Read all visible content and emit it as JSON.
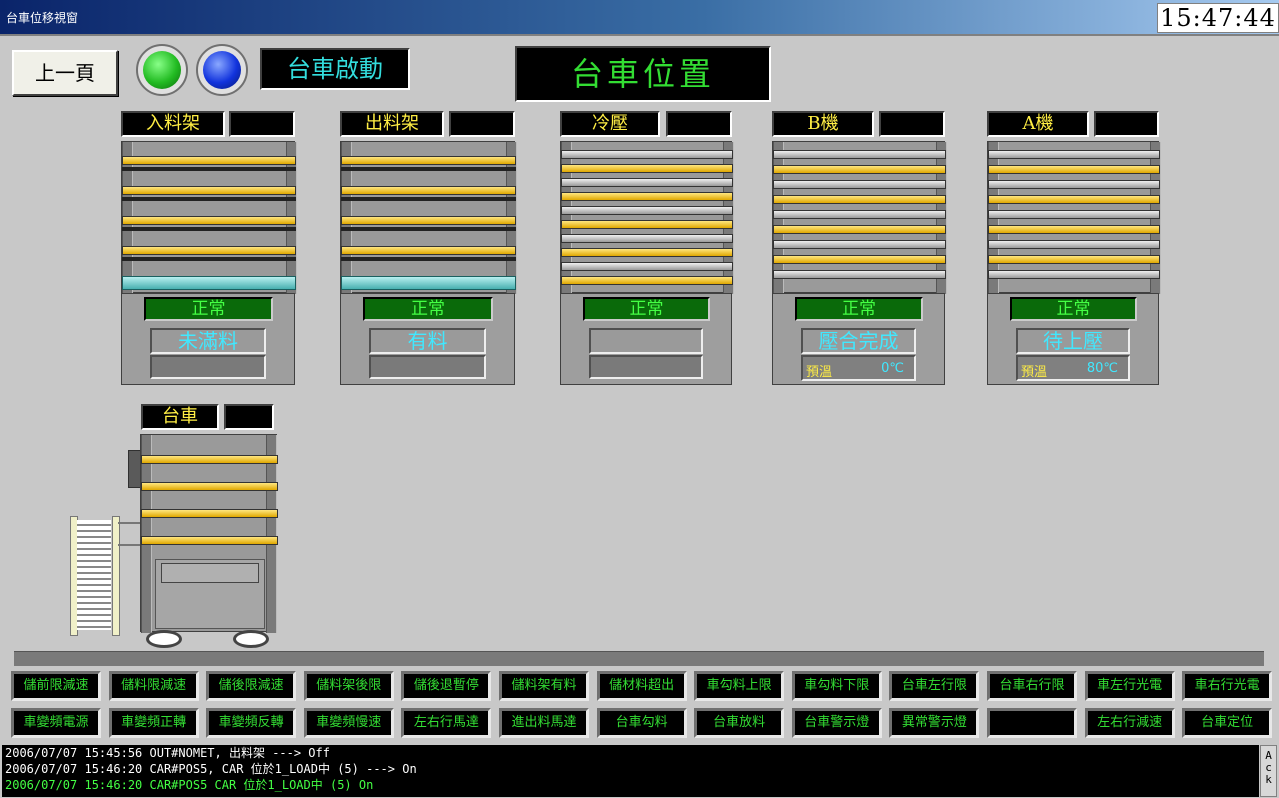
{
  "window": {
    "title": "台車位移視窗",
    "clock": "15:47:44"
  },
  "top": {
    "back_label": "上一頁",
    "start_label": "台車啟動",
    "position_title": "台車位置"
  },
  "colors": {
    "lamp_green": "#22bb22",
    "lamp_blue": "#1133dd",
    "accent_green": "#33dd33",
    "shelf_yellow": "#f2c200"
  },
  "stations": [
    {
      "label": "入料架",
      "value": "",
      "status": "正常",
      "message": "未滿料",
      "detail": ""
    },
    {
      "label": "出料架",
      "value": "",
      "status": "正常",
      "message": "有料",
      "detail": ""
    },
    {
      "label": "冷壓",
      "value": "",
      "status": "正常",
      "message": "",
      "detail": ""
    },
    {
      "label": "B機",
      "value": "",
      "status": "正常",
      "message": "壓合完成",
      "temp_label": "預溫",
      "temp_value": "0℃"
    },
    {
      "label": "A機",
      "value": "",
      "status": "正常",
      "message": "待上壓",
      "temp_label": "預溫",
      "temp_value": "80℃"
    }
  ],
  "cart": {
    "label": "台車",
    "value": ""
  },
  "indicators_row1": [
    "儲前限減速",
    "儲料限減速",
    "儲後限減速",
    "儲料架後限",
    "儲後退暫停",
    "儲料架有料",
    "儲材料超出",
    "車勾料上限",
    "車勾料下限",
    "台車左行限",
    "台車右行限",
    "車左行光電",
    "車右行光電"
  ],
  "indicators_row2": [
    "車變頻電源",
    "車變頻正轉",
    "車變頻反轉",
    "車變頻慢速",
    "左右行馬達",
    "進出料馬達",
    "台車勾料",
    "台車放料",
    "台車警示燈",
    "異常警示燈",
    "",
    "左右行減速",
    "台車定位"
  ],
  "log": [
    {
      "text": "2006/07/07 15:45:56 OUT#NOMET, 出料架 ---> Off",
      "color": "#ffffff"
    },
    {
      "text": "2006/07/07 15:46:20 CAR#POS5, CAR 位於1_LOAD中 (5) ---> On",
      "color": "#ffffff"
    },
    {
      "text": "2006/07/07 15:46:20 CAR#POS5     CAR 位於1_LOAD中 (5) On",
      "color": "#44ff44"
    }
  ],
  "ack_label": "Ack"
}
